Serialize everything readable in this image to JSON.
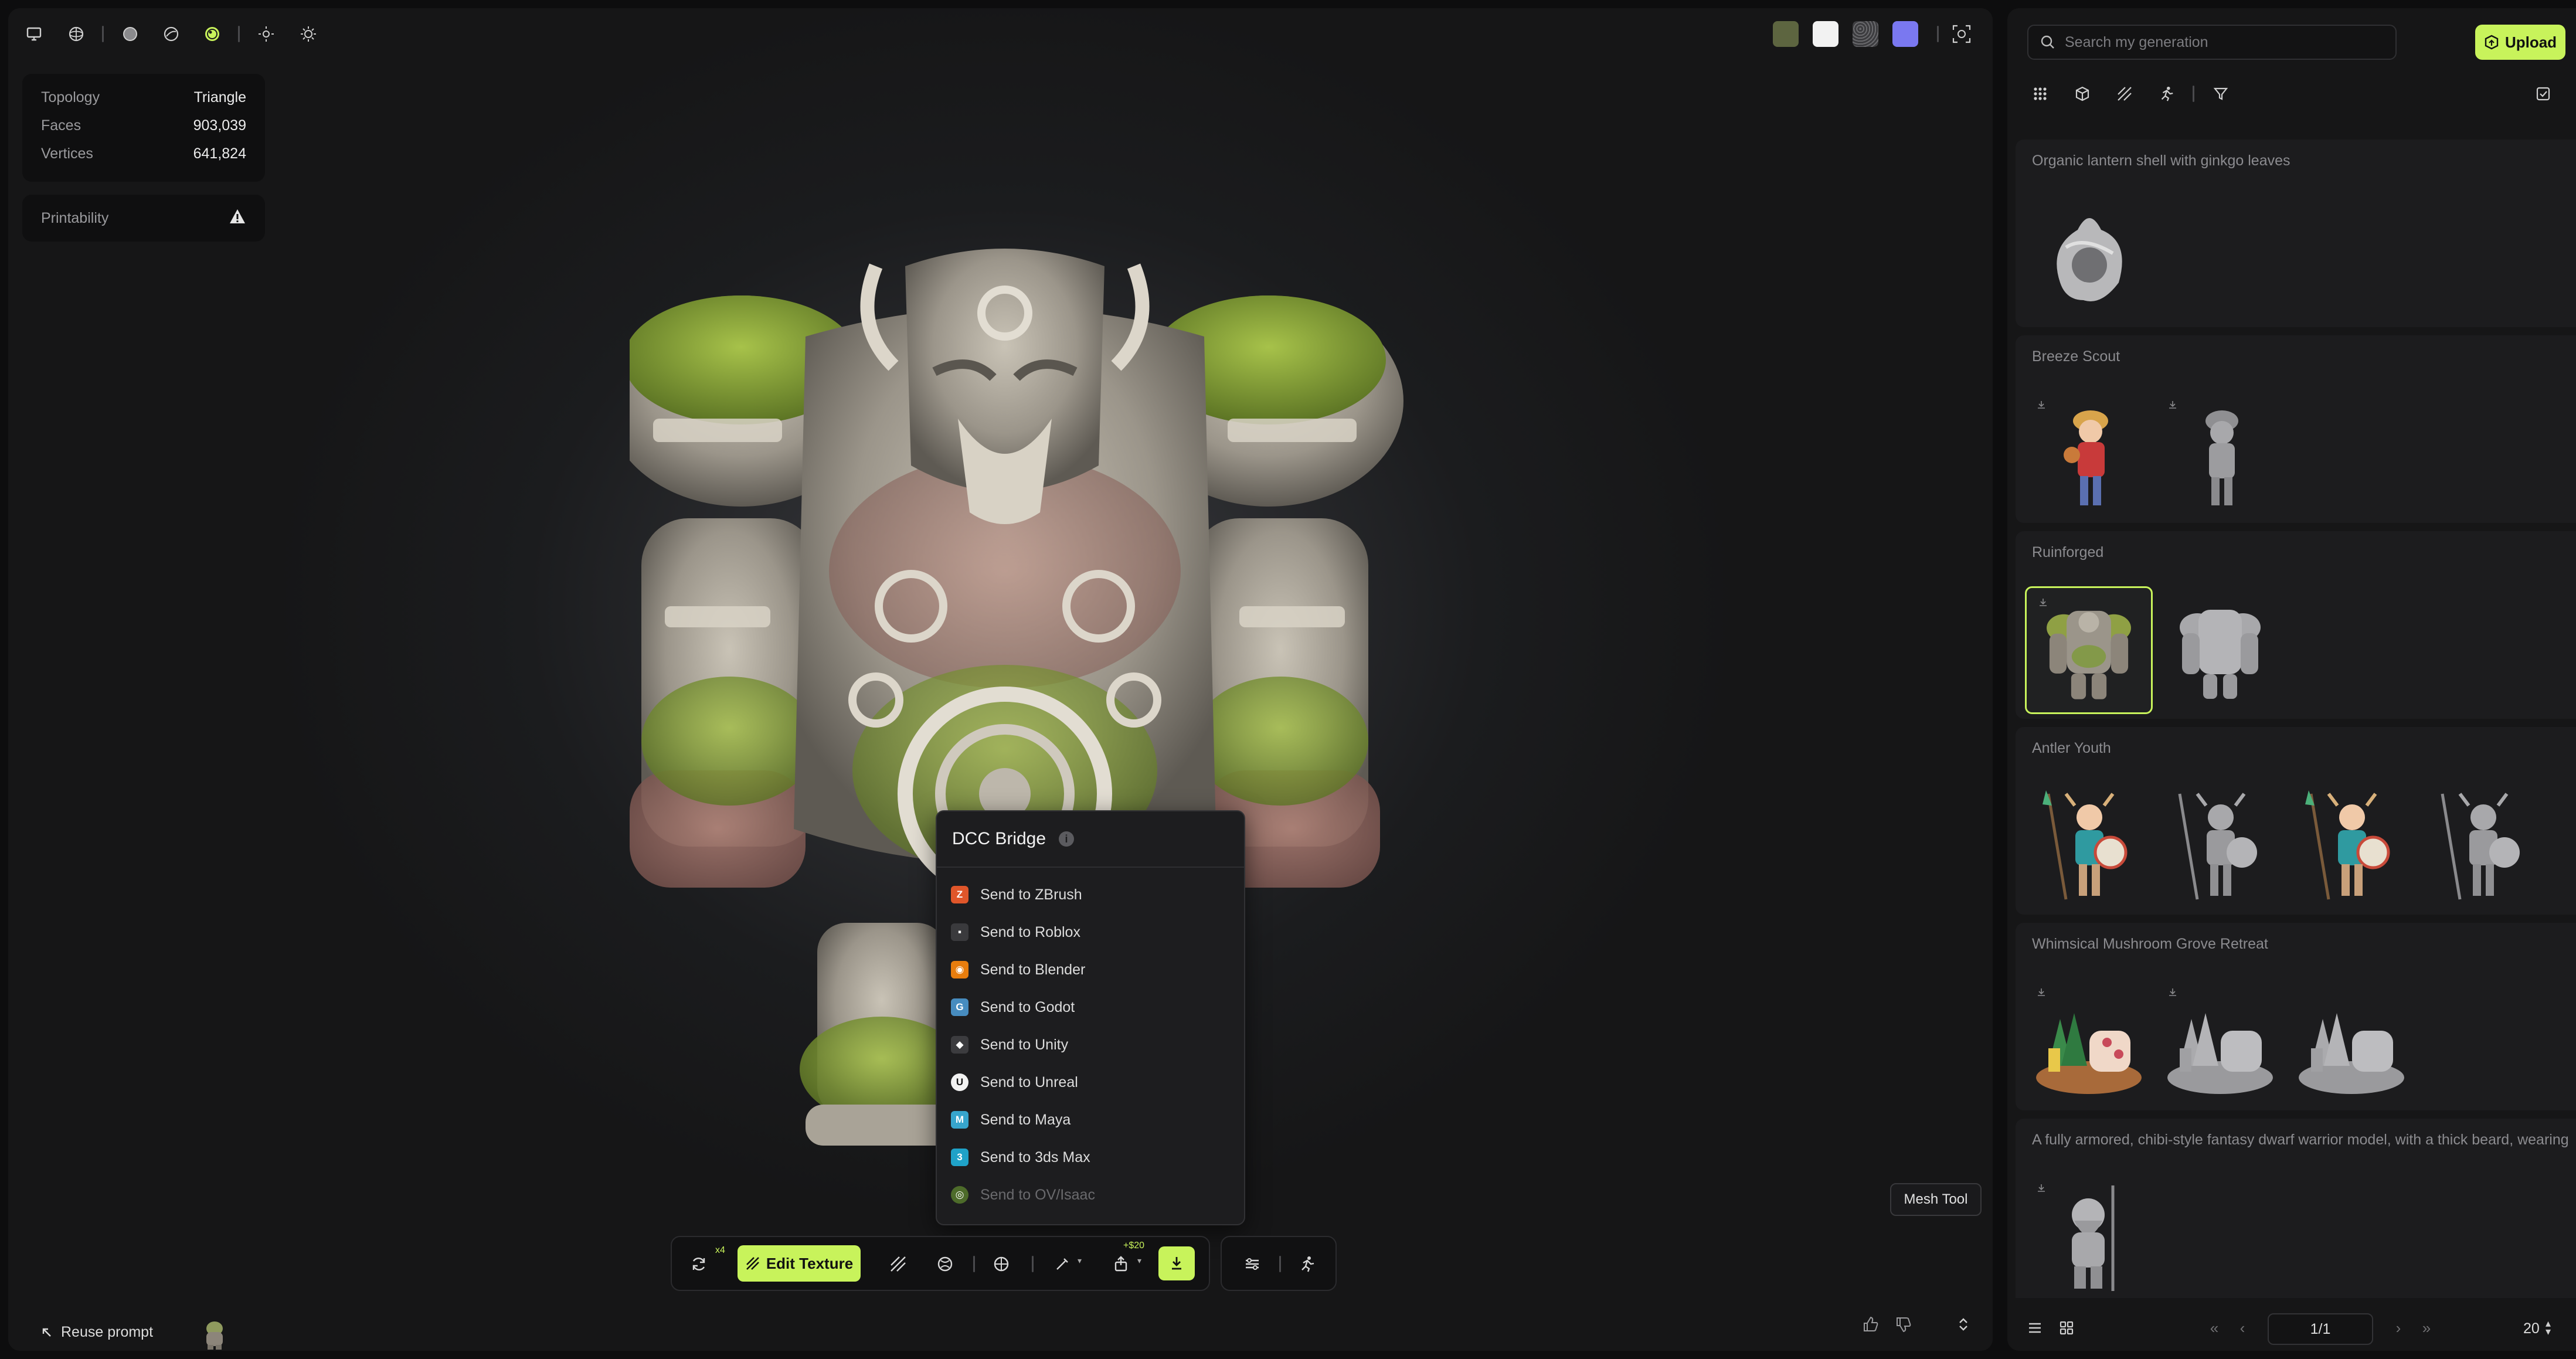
{
  "colors": {
    "accent": "#c8f35b",
    "panel": "#161617",
    "viewport": "#1b1c1e"
  },
  "toolbar": {
    "left_icons": [
      "monitor-icon",
      "wireframe-sphere-icon",
      "solid-sphere-icon",
      "clay-sphere-icon",
      "textured-sphere-icon",
      "light-sun-icon",
      "light-sun-alt-icon"
    ],
    "swatches": [
      "#5d6540",
      "#f2f2f2",
      "#555558",
      "#7a78f0"
    ]
  },
  "mesh_info": {
    "rows": [
      {
        "label": "Topology",
        "value": "Triangle"
      },
      {
        "label": "Faces",
        "value": "903,039"
      },
      {
        "label": "Vertices",
        "value": "641,824"
      }
    ],
    "printability": "Printability"
  },
  "dcc": {
    "title": "DCC Bridge",
    "items": [
      {
        "label": "Send to ZBrush",
        "icon": "zbrush-icon",
        "color": "#e0562a",
        "glyph": "Z"
      },
      {
        "label": "Send to Roblox",
        "icon": "roblox-icon",
        "color": "#3a3a3d",
        "glyph": "▪"
      },
      {
        "label": "Send to Blender",
        "icon": "blender-icon",
        "color": "#e87d0d",
        "glyph": "◉"
      },
      {
        "label": "Send to Godot",
        "icon": "godot-icon",
        "color": "#478cbf",
        "glyph": "G"
      },
      {
        "label": "Send to Unity",
        "icon": "unity-icon",
        "color": "#3c3c3f",
        "glyph": "◆"
      },
      {
        "label": "Send to Unreal",
        "icon": "unreal-icon",
        "color": "#f2f2f2",
        "glyph": "U"
      },
      {
        "label": "Send to Maya",
        "icon": "maya-icon",
        "color": "#37a5cc",
        "glyph": "M"
      },
      {
        "label": "Send to 3ds Max",
        "icon": "3ds-max-icon",
        "color": "#1fa2c8",
        "glyph": "3"
      },
      {
        "label": "Send to OV/Isaac",
        "icon": "omniverse-icon",
        "color": "#4d6b2a",
        "glyph": "◎"
      }
    ]
  },
  "bottom_toolbar": {
    "regen_badge": "x4",
    "edit_texture": "Edit Texture",
    "export_badge": "+$20"
  },
  "mesh_tool": "Mesh Tool",
  "reuse_prompt": "Reuse prompt",
  "right_panel": {
    "search_placeholder": "Search my generation",
    "upload": "Upload",
    "generations": [
      {
        "title": "Organic lantern shell with ginkgo leaves"
      },
      {
        "title": "Breeze Scout"
      },
      {
        "title": "Ruinforged"
      },
      {
        "title": "Antler Youth"
      },
      {
        "title": "Whimsical Mushroom Grove Retreat"
      },
      {
        "title": "A fully armored, chibi-style fantasy dwarf warrior model, with a thick beard, wearing a helmet"
      }
    ],
    "pager": {
      "page": "1/1",
      "page_size": "20"
    }
  }
}
